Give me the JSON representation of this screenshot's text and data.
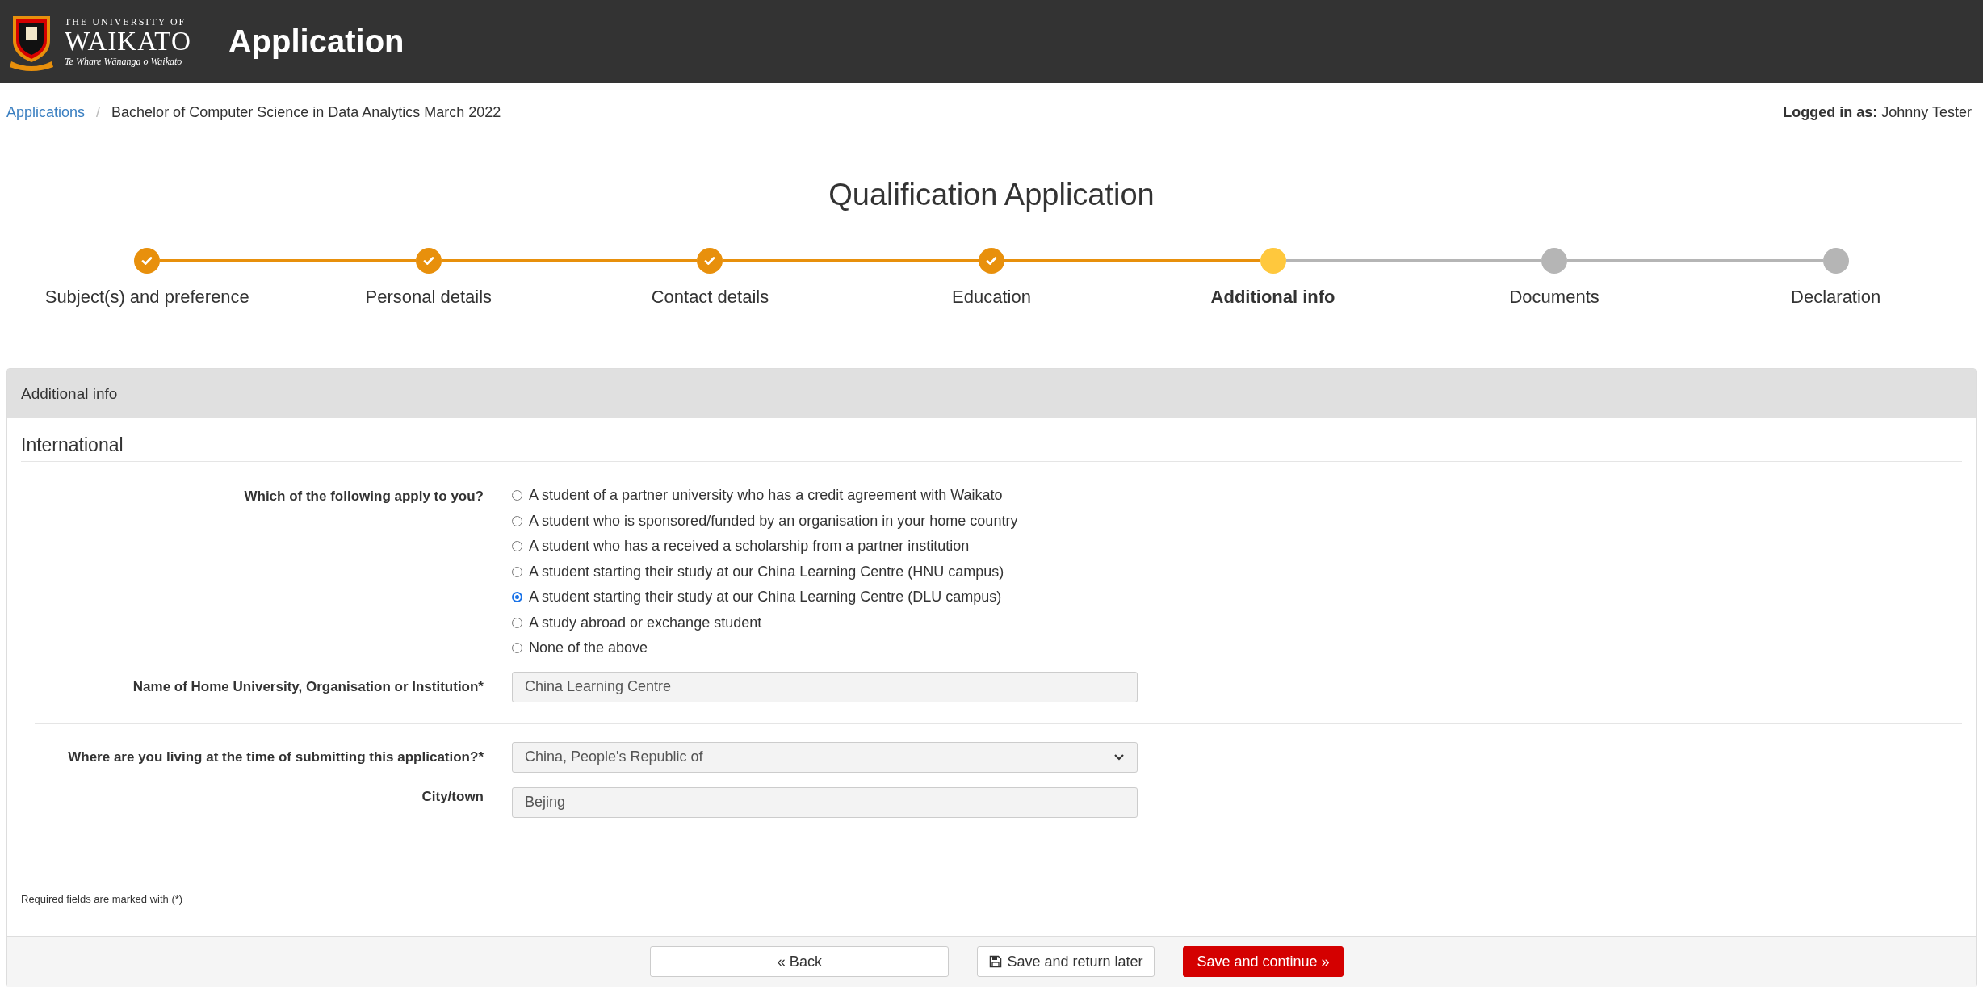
{
  "header": {
    "logo": {
      "line1": "THE UNIVERSITY OF",
      "line2": "WAIKATO",
      "line3": "Te Whare Wānanga o Waikato"
    },
    "title": "Application"
  },
  "breadcrumb": {
    "items": [
      {
        "label": "Applications",
        "link": true
      },
      {
        "label": "Bachelor of Computer Science in Data Analytics March 2022",
        "link": false
      }
    ],
    "separator": "/"
  },
  "user": {
    "label": "Logged in as:",
    "name": "Johnny Tester"
  },
  "page_title": "Qualification Application",
  "steps": [
    {
      "label": "Subject(s) and preference",
      "completed": true,
      "selected": false
    },
    {
      "label": "Personal details",
      "completed": true,
      "selected": false
    },
    {
      "label": "Contact details",
      "completed": true,
      "selected": false
    },
    {
      "label": "Education",
      "completed": true,
      "selected": false
    },
    {
      "label": "Additional info",
      "completed": false,
      "selected": true
    },
    {
      "label": "Documents",
      "completed": false,
      "selected": false
    },
    {
      "label": "Declaration",
      "completed": false,
      "selected": false
    }
  ],
  "panel": {
    "title": "Additional info",
    "section": "International",
    "question": {
      "label": "Which of the following apply to you?",
      "options": [
        {
          "label": "A student of a partner university who has a credit agreement with Waikato",
          "selected": false
        },
        {
          "label": "A student who is sponsored/funded by an organisation in your home country",
          "selected": false
        },
        {
          "label": "A student who has a received a scholarship from a partner institution",
          "selected": false
        },
        {
          "label": "A student starting their study at our China Learning Centre (HNU campus)",
          "selected": false
        },
        {
          "label": "A student starting their study at our China Learning Centre (DLU campus)",
          "selected": true
        },
        {
          "label": "A study abroad or exchange student",
          "selected": false
        },
        {
          "label": "None of the above",
          "selected": false
        }
      ]
    },
    "institution": {
      "label": "Name of Home University, Organisation or Institution*",
      "value": "China Learning Centre"
    },
    "residence": {
      "label": "Where are you living at the time of submitting this application?*",
      "value": "China, People's Republic of"
    },
    "city": {
      "label": "City/town",
      "value": "Bejing"
    },
    "note": "Required fields are marked with (*)",
    "buttons": {
      "back": "« Back",
      "save_later": "Save and return later",
      "continue": "Save and continue »"
    }
  }
}
